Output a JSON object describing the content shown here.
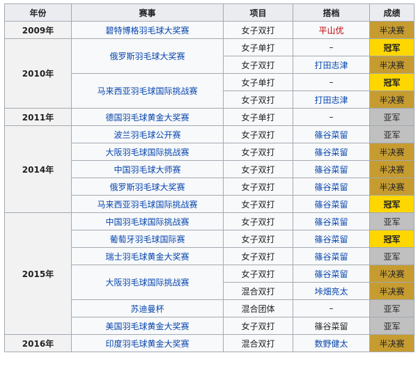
{
  "headers": [
    "年份",
    "赛事",
    "项目",
    "搭档",
    "成绩"
  ],
  "years": [
    "2009年",
    "2010年",
    "2011年",
    "2014年",
    "2015年",
    "2016年"
  ],
  "events": [
    "碧特博格羽毛球大奖赛",
    "俄罗斯羽毛球大奖赛",
    "马来西亚羽毛球国际挑战赛",
    "德国羽毛球黄金大奖赛",
    "波兰羽毛球公开赛",
    "大阪羽毛球国际挑战赛",
    "中国羽毛球大师赛",
    "俄罗斯羽毛球大奖赛",
    "马来西亚羽毛球国际挑战赛",
    "中国羽毛球国际挑战赛",
    "葡萄牙羽毛球国际赛",
    "瑞士羽毛球黄金大奖赛",
    "大阪羽毛球国际挑战赛",
    "苏迪曼杯",
    "美国羽毛球黄金大奖赛",
    "印度羽毛球黄金大奖赛"
  ],
  "rows": [
    {
      "type": "女子双打",
      "partner": "平山优",
      "result": "半决赛"
    },
    {
      "type": "女子单打",
      "partner": "–",
      "result": "冠军"
    },
    {
      "type": "女子双打",
      "partner": "打田志津",
      "result": "半决赛"
    },
    {
      "type": "女子单打",
      "partner": "–",
      "result": "冠军"
    },
    {
      "type": "女子双打",
      "partner": "打田志津",
      "result": "半决赛"
    },
    {
      "type": "女子单打",
      "partner": "–",
      "result": "亚军"
    },
    {
      "type": "女子双打",
      "partner": "篠谷菜留",
      "result": "亚军"
    },
    {
      "type": "女子双打",
      "partner": "篠谷菜留",
      "result": "半决赛"
    },
    {
      "type": "女子双打",
      "partner": "篠谷菜留",
      "result": "半决赛"
    },
    {
      "type": "女子双打",
      "partner": "篠谷菜留",
      "result": "半决赛"
    },
    {
      "type": "女子双打",
      "partner": "篠谷菜留",
      "result": "冠军"
    },
    {
      "type": "女子双打",
      "partner": "篠谷菜留",
      "result": "亚军"
    },
    {
      "type": "女子双打",
      "partner": "篠谷菜留",
      "result": "冠军"
    },
    {
      "type": "女子双打",
      "partner": "篠谷菜留",
      "result": "亚军"
    },
    {
      "type": "女子双打",
      "partner": "篠谷菜留",
      "result": "半决赛"
    },
    {
      "type": "混合双打",
      "partner": "垰畑亮太",
      "result": "半决赛"
    },
    {
      "type": "混合团体",
      "partner": "–",
      "result": "亚军"
    },
    {
      "type": "女子双打",
      "partner": "篠谷菜留",
      "result": "亚军"
    },
    {
      "type": "混合双打",
      "partner": "数野健太",
      "result": "半决赛"
    }
  ],
  "colors": {
    "gold": "#ffd700",
    "bronze": "#c69c31",
    "silver": "#c0c0c0",
    "link": "#0645ad",
    "redlink": "#ba0000",
    "header": "#eaecf0",
    "border": "#a2a9b1"
  }
}
